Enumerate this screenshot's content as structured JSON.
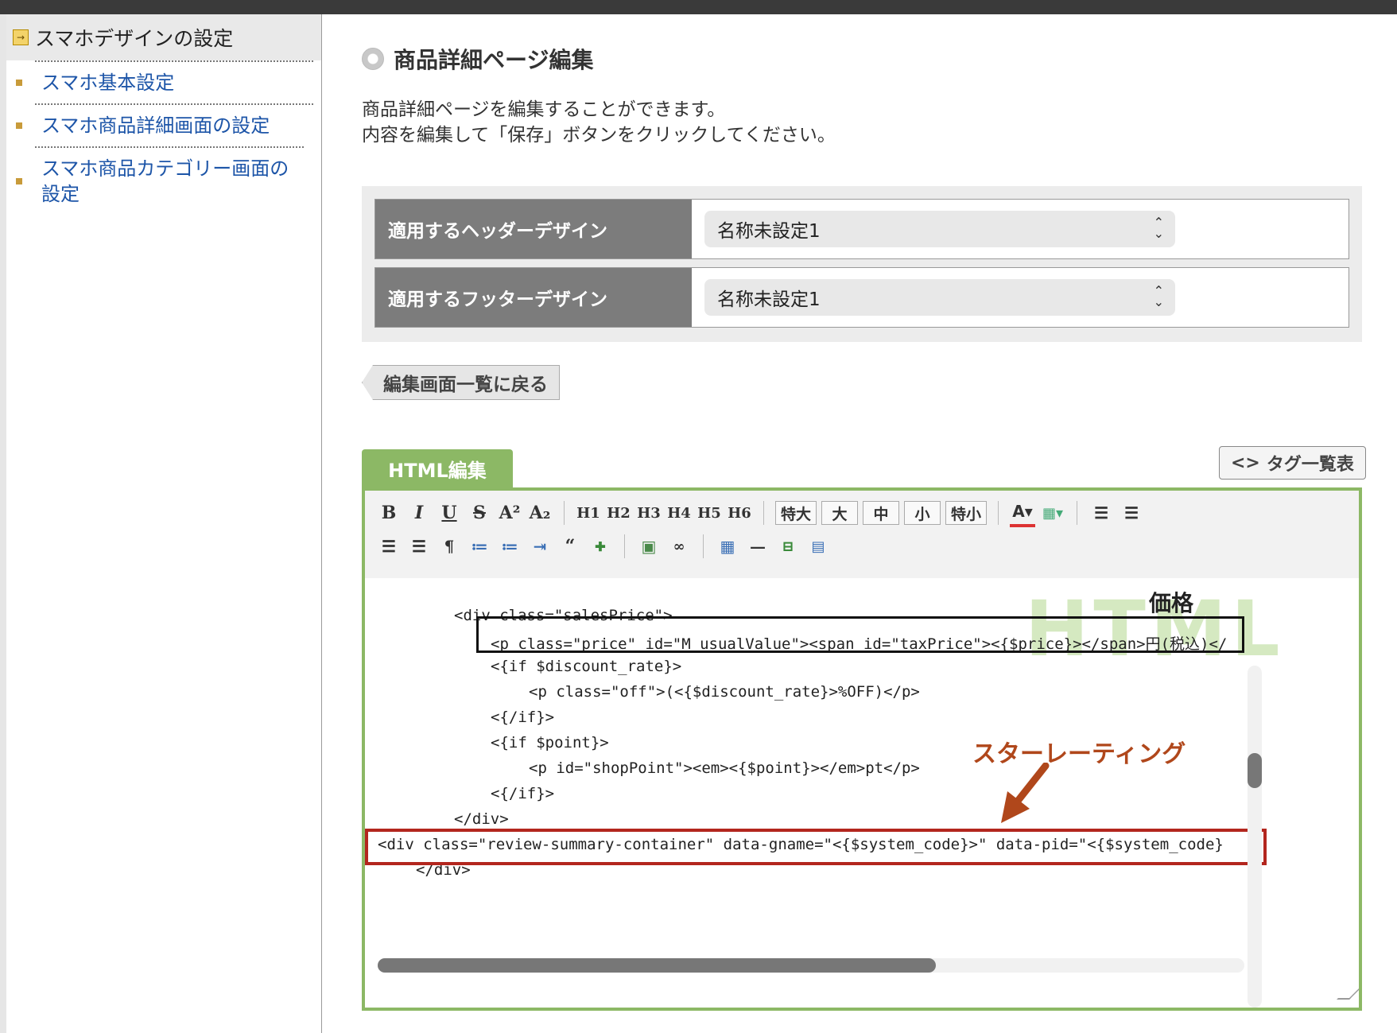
{
  "sidebar": {
    "header": "スマホデザインの設定",
    "items": [
      {
        "label": "スマホ基本設定"
      },
      {
        "label": "スマホ商品詳細画面の設定"
      },
      {
        "label": "スマホ商品カテゴリー画面の設定"
      }
    ]
  },
  "main": {
    "title": "商品詳細ページ編集",
    "desc_line1": "商品詳細ページを編集することができます。",
    "desc_line2": "内容を編集して「保存」ボタンをクリックしてください。",
    "header_design": {
      "label": "適用するヘッダーデザイン",
      "value": "名称未設定1"
    },
    "footer_design": {
      "label": "適用するフッターデザイン",
      "value": "名称未設定1"
    },
    "back_button": "編集画面一覧に戻る",
    "tab_html": "HTML編集",
    "tag_list_button": "タグ一覧表"
  },
  "toolbar": {
    "row1": [
      "B",
      "I",
      "U",
      "S",
      "A²",
      "A₂",
      "H1",
      "H2",
      "H3",
      "H4",
      "H5",
      "H6"
    ],
    "size_buttons": [
      "特大",
      "大",
      "中",
      "小",
      "特小"
    ]
  },
  "editor": {
    "watermark": "HTML",
    "lines": [
      "<div class=\"salesPrice\">",
      "<p class=\"price\" id=\"M_usualValue\"><span id=\"taxPrice\"><{$price}></span>円(税込)</",
      "<{if $discount_rate}>",
      "<p class=\"off\">(<{$discount_rate}>%OFF)</p>",
      "<{/if}>",
      "<{if $point}>",
      "<p id=\"shopPoint\"><em><{$point}></em>pt</p>",
      "<{/if}>",
      "</div>",
      "<div class=\"review-summary-container\" data-gname=\"<{$system_code}>\" data-pid=\"<{$system_code}",
      "</div>"
    ],
    "annotation_price": "価格",
    "annotation_star": "スターレーティング"
  }
}
